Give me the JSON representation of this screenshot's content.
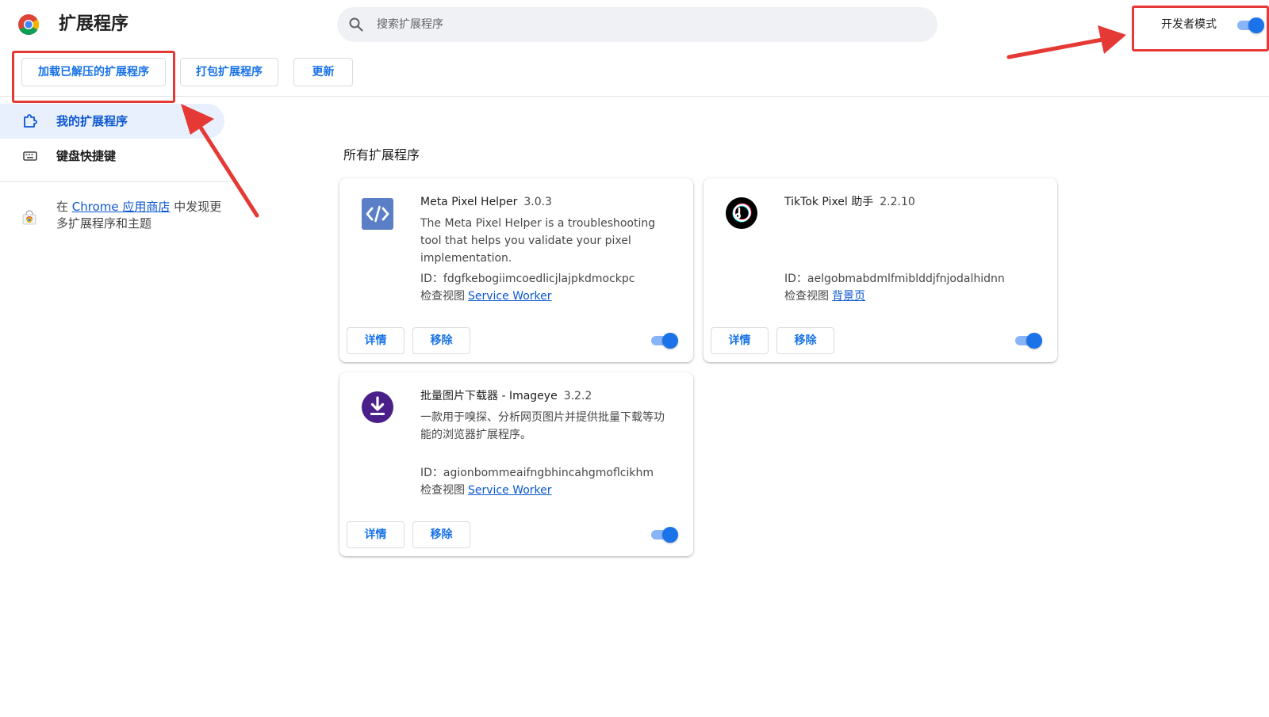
{
  "header": {
    "title": "扩展程序",
    "logo_icon": "chrome-logo-icon",
    "search": {
      "placeholder": "搜索扩展程序",
      "icon": "search-icon"
    },
    "developer_mode": {
      "label": "开发者模式",
      "enabled": true
    }
  },
  "toolbar": {
    "load_unpacked": "加载已解压的扩展程序",
    "pack": "打包扩展程序",
    "update": "更新"
  },
  "sidebar": {
    "items": [
      {
        "label": "我的扩展程序",
        "icon": "puzzle-piece-icon",
        "active": true
      },
      {
        "label": "键盘快捷键",
        "icon": "keyboard-icon",
        "active": false
      }
    ],
    "store": {
      "prefix": "在",
      "link": "Chrome 应用商店",
      "suffix": "中发现更多扩展程序和主题",
      "icon": "chrome-web-store-icon"
    }
  },
  "main": {
    "section_title": "所有扩展程序",
    "extensions": [
      {
        "name": "Meta Pixel Helper",
        "version": "3.0.3",
        "description": "The Meta Pixel Helper is a troubleshooting tool that helps you validate your pixel implementation.",
        "id": "ID：fdgfkebogiimcoedlicjlajpkdmockpc",
        "inspect_label": "检查视图",
        "inspect_link": "Service Worker",
        "details": "详情",
        "remove": "移除",
        "enabled": true,
        "icon": "code-brackets-icon"
      },
      {
        "name": "TikTok Pixel 助手",
        "version": "2.2.10",
        "description": "",
        "id": "ID：aelgobmabdmlfmiblddjfnjodalhidnn",
        "inspect_label": "检查视图",
        "inspect_link": "背景页",
        "details": "详情",
        "remove": "移除",
        "enabled": true,
        "icon": "tiktok-icon"
      },
      {
        "name": "批量图片下载器 - Imageye",
        "version": "3.2.2",
        "description": "一款用于嗅探、分析网页图片并提供批量下载等功能的浏览器扩展程序。",
        "id": "ID：agionbommeaifngbhincahgmoflcikhm",
        "inspect_label": "检查视图",
        "inspect_link": "Service Worker",
        "details": "详情",
        "remove": "移除",
        "enabled": true,
        "icon": "download-icon"
      }
    ]
  },
  "colors": {
    "accent": "#1a73e8",
    "link": "#0b57d0",
    "toggle_track": "#8ab4f8",
    "annotation_red": "#e53935",
    "sidebar_active_bg": "#e8effd"
  }
}
